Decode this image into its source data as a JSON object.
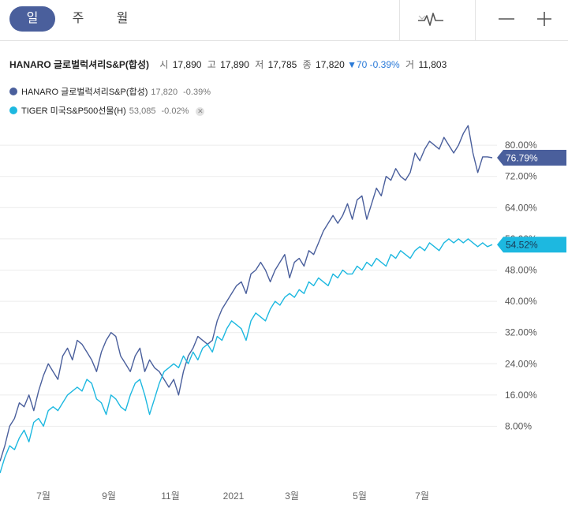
{
  "tabs": [
    {
      "label": "일",
      "active": true
    },
    {
      "label": "주",
      "active": false
    },
    {
      "label": "월",
      "active": false
    }
  ],
  "toolbar": {
    "chart_type_icon": "line-chart-icon",
    "dropdown_icon": "chevron-down-icon",
    "zoom_out_icon": "minus-icon",
    "zoom_in_icon": "plus-icon"
  },
  "quote": {
    "name": "HANARO 글로벌럭셔리S&P(합성)",
    "open_label": "시",
    "open": "17,890",
    "high_label": "고",
    "high": "17,890",
    "low_label": "저",
    "low": "17,785",
    "close_label": "종",
    "close": "17,820",
    "change": "▼70",
    "change_pct": "-0.39%",
    "volume_label": "거",
    "volume": "11,803"
  },
  "legend": [
    {
      "name": "HANARO 글로벌럭셔리S&P(합성)",
      "value": "17,820",
      "change": "-0.39%",
      "color": "#4a5f9c",
      "removable": false
    },
    {
      "name": "TIGER 미국S&P500선물(H)",
      "value": "53,085",
      "change": "-0.02%",
      "color": "#1db8e0",
      "removable": true
    }
  ],
  "colors": {
    "accent": "#4a5f9c",
    "series1": "#4a5f9c",
    "series2": "#1db8e0",
    "down": "#2a7ad8",
    "grid": "#ececec"
  },
  "chart_data": {
    "type": "line",
    "x_ticks": [
      "7월",
      "9월",
      "11월",
      "2021",
      "3월",
      "5월",
      "7월"
    ],
    "y_ticks": [
      "8.00%",
      "16.00%",
      "24.00%",
      "32.00%",
      "40.00%",
      "48.00%",
      "56.00%",
      "64.00%",
      "72.00%",
      "80.00%"
    ],
    "y_tick_values": [
      8,
      16,
      24,
      32,
      40,
      48,
      56,
      64,
      72,
      80
    ],
    "ylim": [
      -6,
      88
    ],
    "grid": true,
    "series": [
      {
        "name": "HANARO 글로벌럭셔리S&P(합성)",
        "last_label": "76.79%",
        "values": [
          -1,
          3,
          8,
          10,
          14,
          13,
          16,
          12,
          17,
          21,
          24,
          22,
          20,
          26,
          28,
          25,
          30,
          29,
          27,
          25,
          22,
          27,
          30,
          32,
          31,
          26,
          24,
          22,
          26,
          28,
          22,
          25,
          23,
          22,
          20,
          18,
          20,
          16,
          22,
          26,
          28,
          31,
          30,
          29,
          30,
          35,
          38,
          40,
          42,
          44,
          45,
          42,
          47,
          48,
          50,
          48,
          45,
          48,
          50,
          52,
          46,
          50,
          51,
          49,
          53,
          52,
          55,
          58,
          60,
          62,
          60,
          62,
          65,
          61,
          66,
          67,
          61,
          65,
          69,
          67,
          72,
          71,
          74,
          72,
          71,
          73,
          78,
          76,
          79,
          81,
          80,
          79,
          82,
          80,
          78,
          80,
          83,
          85,
          78,
          73,
          77,
          77,
          76.79
        ]
      },
      {
        "name": "TIGER 미국S&P500선물(H)",
        "last_label": "54.52%",
        "values": [
          -4,
          0,
          3,
          2,
          5,
          7,
          4,
          9,
          10,
          8,
          12,
          13,
          12,
          14,
          16,
          17,
          18,
          17,
          20,
          19,
          15,
          14,
          11,
          16,
          15,
          13,
          12,
          16,
          19,
          20,
          16,
          11,
          15,
          19,
          22,
          23,
          24,
          23,
          26,
          24,
          27,
          25,
          28,
          29,
          27,
          31,
          30,
          33,
          35,
          34,
          33,
          30,
          35,
          37,
          36,
          35,
          38,
          40,
          39,
          41,
          42,
          41,
          43,
          42,
          45,
          44,
          46,
          45,
          44,
          47,
          46,
          48,
          47,
          47,
          49,
          48,
          50,
          49,
          51,
          50,
          49,
          52,
          51,
          53,
          52,
          51,
          53,
          54,
          53,
          55,
          54,
          53,
          55,
          56,
          55,
          56,
          55,
          56,
          55,
          54,
          55,
          54,
          54.52
        ]
      }
    ]
  }
}
